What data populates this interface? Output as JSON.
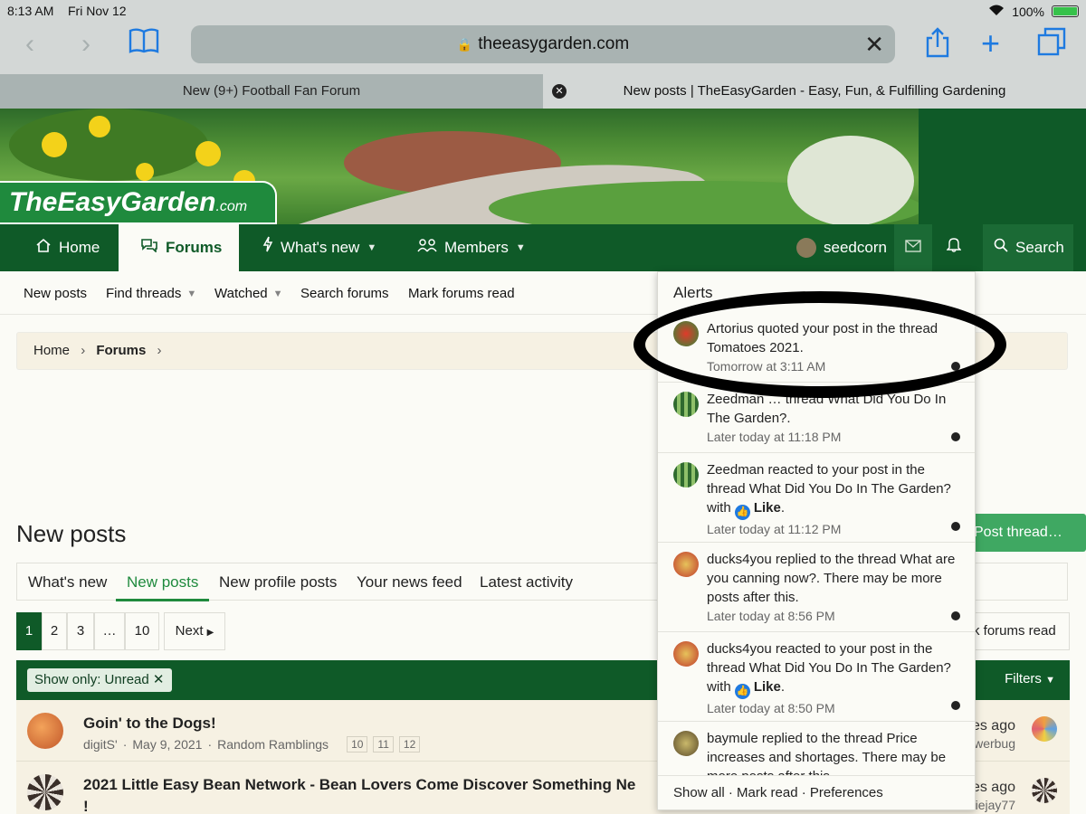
{
  "status": {
    "time": "8:13 AM",
    "day": "Fri Nov 12",
    "battery": "100%"
  },
  "browser": {
    "url": "theeasygarden.com"
  },
  "tabs": [
    {
      "label": "New (9+) Football Fan Forum"
    },
    {
      "label": "New posts | TheEasyGarden - Easy, Fun, & Fulfilling Gardening"
    }
  ],
  "logo": {
    "main": "TheEasyGarden",
    "suffix": ".com"
  },
  "nav": {
    "home": "Home",
    "forums": "Forums",
    "whats_new": "What's new",
    "members": "Members",
    "user": "seedcorn",
    "search": "Search"
  },
  "subnav": {
    "new_posts": "New posts",
    "find_threads": "Find threads",
    "watched": "Watched",
    "search_forums": "Search forums",
    "mark_read": "Mark forums read"
  },
  "breadcrumb": {
    "home": "Home",
    "forums": "Forums"
  },
  "page": {
    "title": "New posts",
    "post_thread": "Post thread…"
  },
  "content_tabs": [
    "What's new",
    "New posts",
    "New profile posts",
    "Your news feed",
    "Latest activity"
  ],
  "pager": {
    "pages": [
      "1",
      "2",
      "3",
      "…",
      "10"
    ],
    "next": "Next",
    "mark_read": "k forums read"
  },
  "filter": {
    "label": "Show only:",
    "value": "Unread",
    "filters": "Filters"
  },
  "threads": [
    {
      "title": "Goin' to the Dogs!",
      "author": "digitS'",
      "date": "May 9, 2021",
      "forum": "Random Ramblings",
      "pages": [
        "10",
        "11",
        "12"
      ],
      "ago": "es ago",
      "last": "werbug"
    },
    {
      "title": "2021 Little Easy Bean Network - Bean Lovers Come Discover Something Ne",
      "title_cont": "!",
      "ago": "es ago",
      "last": "iejay77"
    }
  ],
  "alerts": {
    "header": "Alerts",
    "items": [
      {
        "text": "Artorius quoted your post in the thread Tomatoes 2021.",
        "time": "Tomorrow at 3:11 AM"
      },
      {
        "text": "Zeedman … thread What Did You Do In The Garden?.",
        "time": "Later today at 11:18 PM"
      },
      {
        "text_a": "Zeedman reacted to your post in the thread What Did You Do In The Garden? with ",
        "reaction": "Like",
        "time": "Later today at 11:12 PM"
      },
      {
        "text": "ducks4you replied to the thread What are you canning now?. There may be more posts after this.",
        "time": "Later today at 8:56 PM"
      },
      {
        "text_a": "ducks4you reacted to your post in the thread What Did You Do In The Garden? with ",
        "reaction": "Like",
        "time": "Later today at 8:50 PM"
      },
      {
        "text": "baymule replied to the thread Price increases and shortages. There may be more posts after this."
      }
    ],
    "footer": "Show all · Mark read · Preferences"
  }
}
